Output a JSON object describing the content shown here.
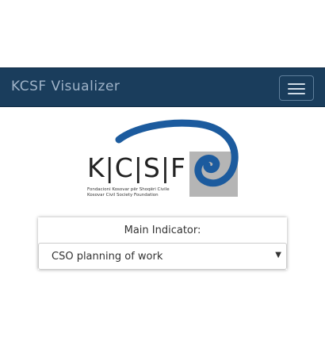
{
  "navbar": {
    "brand": "KCSF Visualizer",
    "background": "#1a3d5c",
    "toggle_icon": "hamburger-menu-icon"
  },
  "logo": {
    "letters": "K|C|S|F",
    "subtitle_line1": "Fondacioni Kosovar për Shoqëri Civile",
    "subtitle_line2": "Kosovar Civil Society Foundation",
    "accent_color": "#1c5b9e"
  },
  "indicator": {
    "label": "Main Indicator:",
    "selected": "CSO planning of work",
    "caret_icon": "chevron-down-icon"
  }
}
